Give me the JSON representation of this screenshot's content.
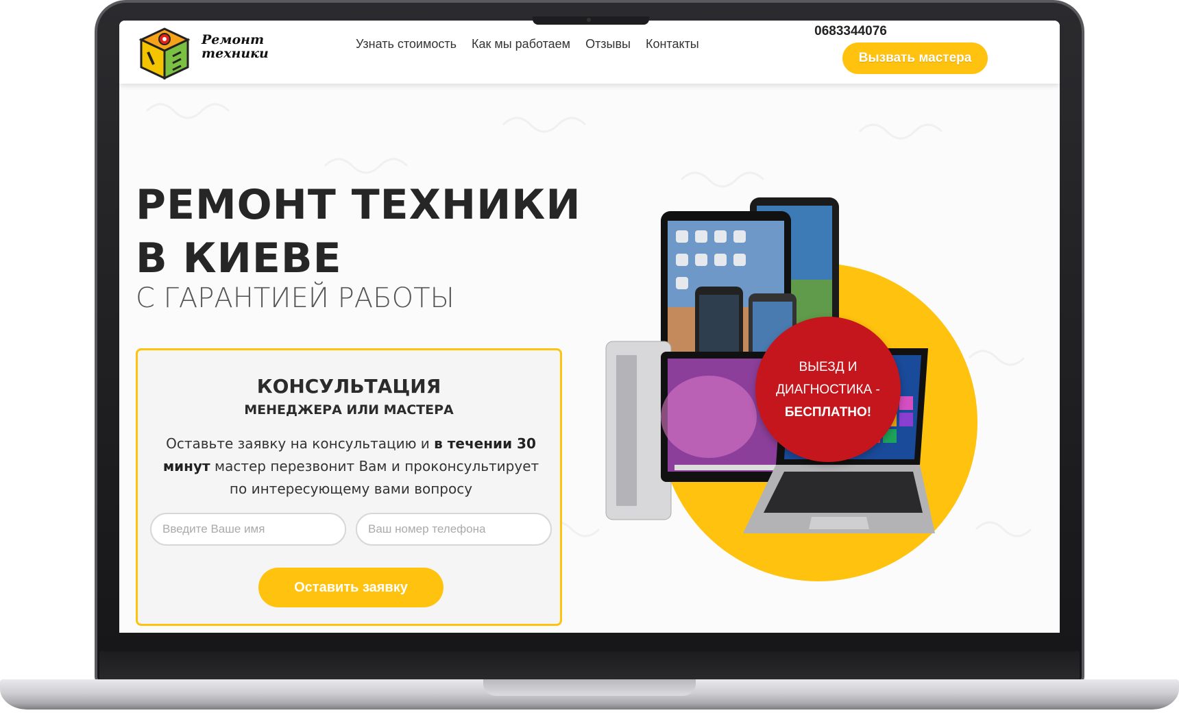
{
  "header": {
    "logo_line1": "Ремонт",
    "logo_line2": "техники",
    "nav": [
      {
        "label": "Узнать стоимость"
      },
      {
        "label": "Как мы работаем"
      },
      {
        "label": "Отзывы"
      },
      {
        "label": "Контакты"
      }
    ],
    "phone": "0683344076",
    "call_button": "Вызвать мастера"
  },
  "hero": {
    "title_line1": "РЕМОНТ ТЕХНИКИ",
    "title_line2": "В КИЕВЕ",
    "subtitle": "С ГАРАНТИЕЙ РАБОТЫ"
  },
  "consult": {
    "title": "КОНСУЛЬТАЦИЯ",
    "subtitle": "МЕНЕДЖЕРА ИЛИ МАСТЕРА",
    "text_before": "Оставьте заявку на консультацию и ",
    "text_bold": "в течении 30 минут",
    "text_after": " мастер перезвонит Вам и проконсультирует по интересующему вами вопросу",
    "name_placeholder": "Введите Ваше имя",
    "phone_placeholder": "Ваш номер телефона",
    "submit": "Оставить заявку"
  },
  "promo": {
    "line1": "ВЫЕЗД И",
    "line2": "ДИАГНОСТИКА -",
    "line3": "БЕСПЛАТНО!"
  },
  "colors": {
    "accent": "#ffc20e",
    "promo_red": "#c4161c",
    "text_dark": "#262626"
  },
  "icons": {
    "logo": "repair-cube-logo-icon"
  }
}
